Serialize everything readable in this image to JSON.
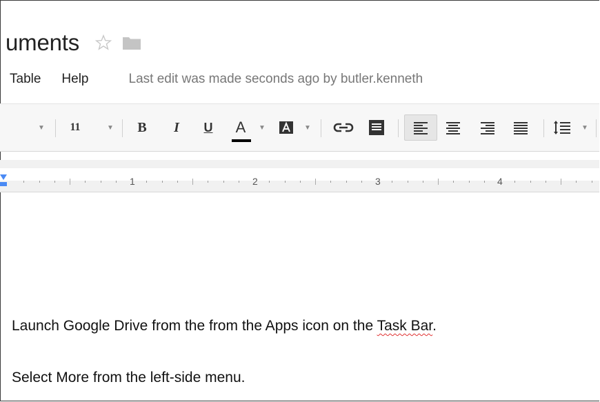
{
  "header": {
    "title": "uments"
  },
  "menu": {
    "items": [
      "Table",
      "Help"
    ],
    "last_edit": "Last edit was made seconds ago by butler.kenneth"
  },
  "toolbar": {
    "font_size": "11",
    "bold_label": "B",
    "italic_label": "I",
    "underline_label": "U",
    "text_color_label": "A",
    "text_color": "#000000"
  },
  "ruler": {
    "numbers": [
      "1",
      "2",
      "3",
      "4"
    ]
  },
  "document": {
    "line1_before": "Launch Google Drive from the from the Apps icon on the ",
    "line1_misspelled": "Task Bar",
    "line1_after": ".",
    "line2": "Select More from the left-side menu."
  }
}
